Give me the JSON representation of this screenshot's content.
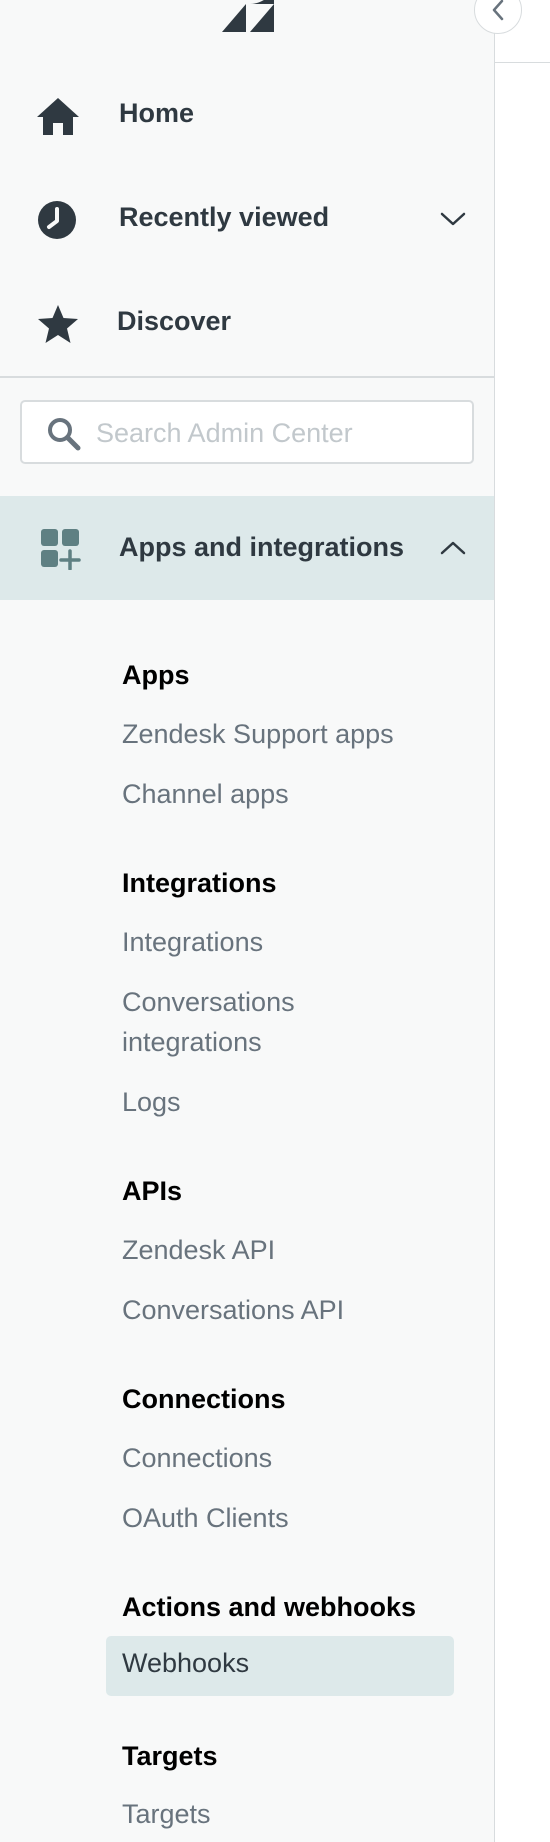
{
  "nav": {
    "home": {
      "label": "Home",
      "icon": "home-icon"
    },
    "recently_viewed": {
      "label": "Recently viewed",
      "icon": "clock-icon",
      "chevron": "chevron-down-icon"
    },
    "discover": {
      "label": "Discover",
      "icon": "star-icon"
    }
  },
  "search": {
    "placeholder": "Search Admin Center",
    "value": ""
  },
  "section": {
    "label": "Apps and integrations",
    "icon": "apps-add-icon",
    "chevron": "chevron-up-icon",
    "expanded": true
  },
  "groups": [
    {
      "heading": "Apps",
      "links": [
        "Zendesk Support apps",
        "Channel apps"
      ]
    },
    {
      "heading": "Integrations",
      "links": [
        "Integrations",
        "Conversations integrations",
        "Logs"
      ]
    },
    {
      "heading": "APIs",
      "links": [
        "Zendesk API",
        "Conversations API"
      ]
    },
    {
      "heading": "Connections",
      "links": [
        "Connections",
        "OAuth Clients"
      ]
    },
    {
      "heading": "Actions and webhooks",
      "links": [
        "Webhooks"
      ],
      "active": "Webhooks"
    },
    {
      "heading": "Targets",
      "links": [
        "Targets"
      ]
    }
  ],
  "colors": {
    "sidebar_bg": "#f8f9f9",
    "active_bg": "#dde9ea",
    "icon_dark": "#2f3941",
    "icon_teal": "#5f8083",
    "link_gray": "#68737d",
    "heading": "#000000"
  }
}
